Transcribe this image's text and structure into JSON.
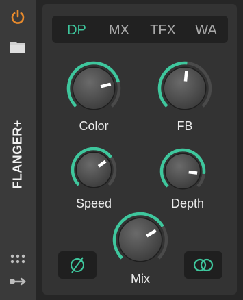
{
  "device": {
    "title": "FLANGER+"
  },
  "tabs": [
    {
      "label": "DP",
      "active": true
    },
    {
      "label": "MX",
      "active": false
    },
    {
      "label": "TFX",
      "active": false
    },
    {
      "label": "WA",
      "active": false
    }
  ],
  "knobs": [
    {
      "id": "color",
      "label": "Color",
      "value": 0.78
    },
    {
      "id": "fb",
      "label": "FB",
      "value": 0.52
    },
    {
      "id": "speed",
      "label": "Speed",
      "value": 0.7
    },
    {
      "id": "depth",
      "label": "Depth",
      "value": 0.86
    },
    {
      "id": "mix",
      "label": "Mix",
      "value": 0.72
    }
  ],
  "buttons": {
    "phase_invert_icon": "phase-invert-icon",
    "stereo_link_icon": "stereo-link-icon"
  },
  "colors": {
    "accent": "#3ec79d",
    "power": "#e88a2c",
    "track": "#4a4a4a"
  },
  "icons": [
    "power-icon",
    "folder-icon",
    "grid-dots-icon",
    "route-icon"
  ]
}
